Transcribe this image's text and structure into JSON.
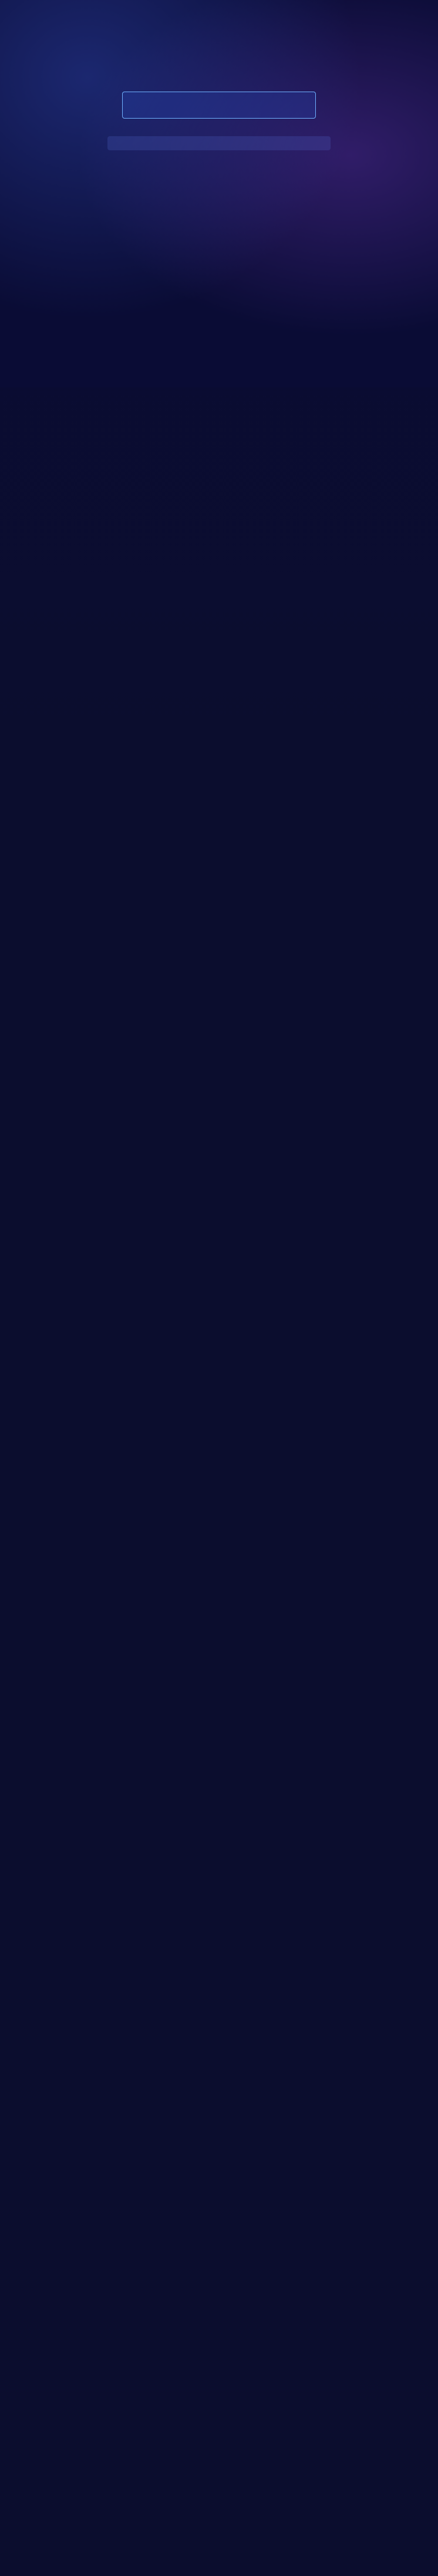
{
  "header": {
    "logo_text": "",
    "conf_title": "",
    "forum_title": "",
    "date_time": "",
    "venue": ""
  },
  "speakers": [],
  "sponsors": []
}
